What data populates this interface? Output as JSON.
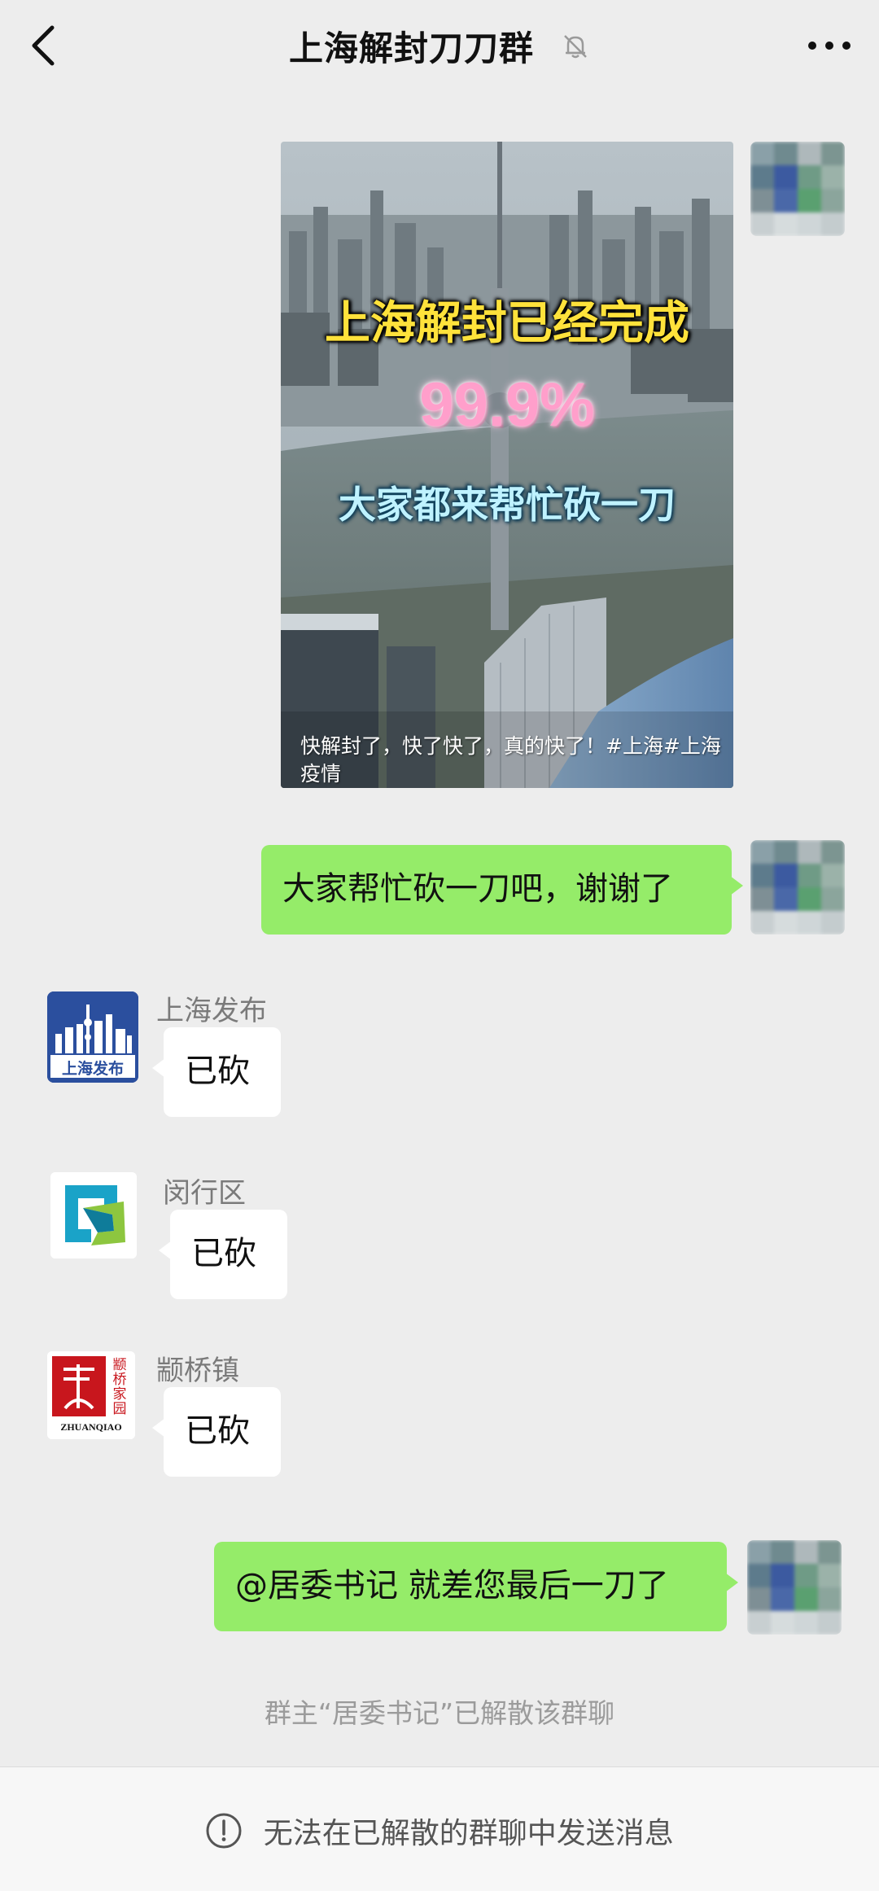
{
  "header": {
    "title": "上海解封刀刀群",
    "back_icon": "chevron-left-icon",
    "mute_icon": "bell-off-icon",
    "more_icon": "more-dots-icon"
  },
  "image_message": {
    "line1": "上海解封已经完成",
    "line2": "99.9%",
    "line3": "大家都来帮忙砍一刀",
    "caption": "快解封了，快了快了，真的快了！#上海#上海疫情"
  },
  "messages": [
    {
      "side": "right",
      "text": "大家帮忙砍一刀吧，谢谢了"
    },
    {
      "side": "left",
      "sender": "上海发布",
      "avatar_text": "上海发布",
      "text": "已砍"
    },
    {
      "side": "left",
      "sender": "闵行区",
      "text": "已砍"
    },
    {
      "side": "left",
      "sender": "颛桥镇",
      "avatar_text": "ZHUANQIAO",
      "avatar_vertical": "颛桥家园",
      "text": "已砍"
    },
    {
      "side": "right",
      "text": "@居委书记 就差您最后一刀了"
    }
  ],
  "system_notice": "群主“居委书记”已解散该群聊",
  "footer": {
    "icon": "warning-circle-icon",
    "text": "无法在已解散的群聊中发送消息"
  },
  "colors": {
    "background": "#ededed",
    "green_bubble": "#95ec69",
    "white_bubble": "#ffffff",
    "shanghai_fabu_blue": "#2b4f9e",
    "zhuanqiao_red": "#c8161d"
  }
}
